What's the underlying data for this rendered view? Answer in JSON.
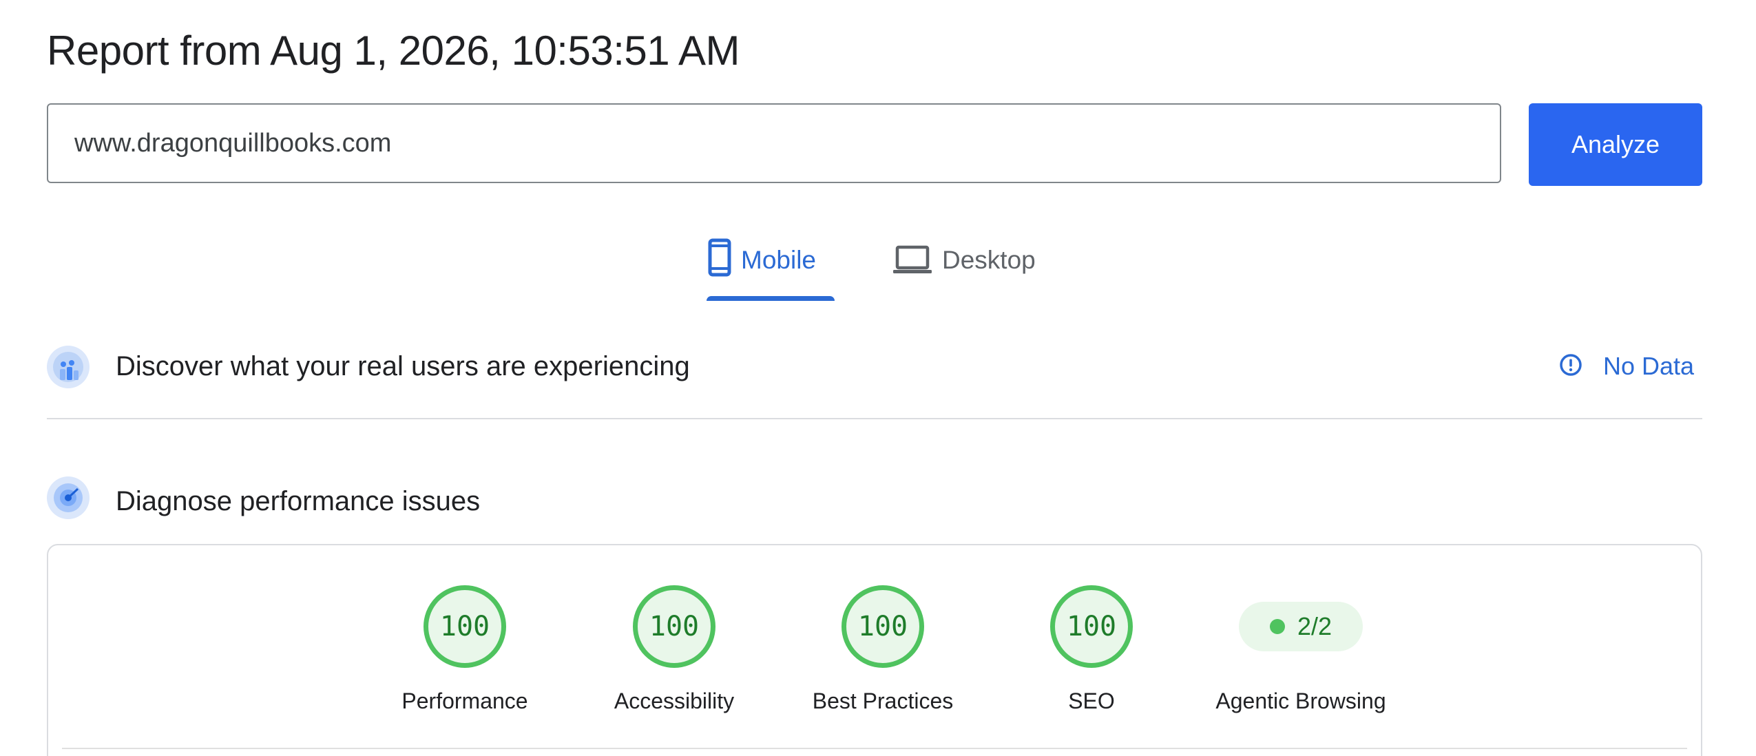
{
  "header": {
    "title": "Report from Aug 1, 2026, 10:53:51 AM"
  },
  "search": {
    "url_value": "www.dragonquillbooks.com",
    "analyze_label": "Analyze"
  },
  "tabs": [
    {
      "label": "Mobile",
      "icon": "phone-icon",
      "selected": true
    },
    {
      "label": "Desktop",
      "icon": "laptop-icon",
      "selected": false
    }
  ],
  "field_data": {
    "heading": "Discover what your real users are experiencing",
    "status_icon": "info-icon",
    "status_label": "No Data"
  },
  "diagnose": {
    "heading": "Diagnose performance issues",
    "scores": [
      {
        "label": "Performance",
        "value": "100"
      },
      {
        "label": "Accessibility",
        "value": "100"
      },
      {
        "label": "Best Practices",
        "value": "100"
      },
      {
        "label": "SEO",
        "value": "100"
      }
    ],
    "agentic": {
      "label": "Agentic Browsing",
      "value": "2/2"
    }
  },
  "colors": {
    "accent": "#2a66f0",
    "tab_active": "#2b6ad4",
    "score_good": "#4fc35f",
    "score_good_text": "#1e7c2a",
    "score_good_bg": "#e9f7ea"
  }
}
